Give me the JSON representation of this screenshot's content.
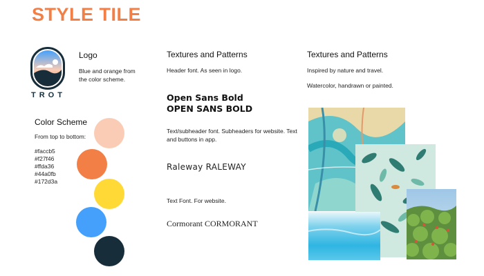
{
  "page": {
    "title": "STYLE TILE"
  },
  "logo": {
    "heading": "Logo",
    "brand_text": "TROT",
    "description": "Blue and orange from the color scheme."
  },
  "color_scheme": {
    "heading": "Color Scheme",
    "intro": "From top to bottom:",
    "colors": [
      "#faccb5",
      "#f27f46",
      "#ffda36",
      "#44a0fb",
      "#172d3a"
    ]
  },
  "typography": {
    "heading": "Textures and Patterns",
    "header_note": "Header font. As seen in logo.",
    "sample_bold_1": "Open Sans Bold",
    "sample_bold_2": "OPEN SANS BOLD",
    "subheader_note": "Text/subheader font. Subheaders for website. Text and buttons in app.",
    "sample_raleway": "Raleway RALEWAY",
    "text_note": "Text Font. For website.",
    "sample_cormorant": "Cormorant CORMORANT"
  },
  "textures": {
    "heading": "Textures and Patterns",
    "note_1": "Inspired by nature and travel.",
    "note_2": "Watercolor, handrawn or painted."
  }
}
